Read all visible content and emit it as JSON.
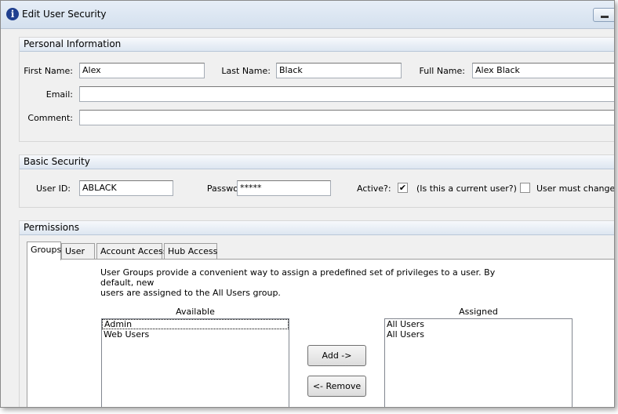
{
  "window": {
    "title": "Edit User Security"
  },
  "personal": {
    "header": "Personal Information",
    "first_name_label": "First Name:",
    "first_name": "Alex",
    "last_name_label": "Last Name:",
    "last_name": "Black",
    "full_name_label": "Full Name:",
    "full_name": "Alex Black",
    "email_label": "Email:",
    "email": "",
    "comment_label": "Comment:",
    "comment": ""
  },
  "security": {
    "header": "Basic Security",
    "user_id_label": "User ID:",
    "user_id": "ABLACK",
    "password_label": "Password:",
    "password": "*****",
    "active_label": "Active?:",
    "active_checked": true,
    "active_hint": "(Is this a current user?)",
    "must_change_checked": false,
    "must_change_label": "User must change pa"
  },
  "permissions": {
    "header": "Permissions",
    "tabs": [
      {
        "label": "Groups",
        "active": true
      },
      {
        "label": "User",
        "active": false
      },
      {
        "label": "Account Access",
        "active": false
      },
      {
        "label": "Hub Access",
        "active": false
      }
    ],
    "description_line1": "User Groups provide a convenient way to assign a predefined set of privileges to a user.  By default, new",
    "description_line2": "users are assigned to the All Users group.",
    "available_label": "Available",
    "available": [
      "Admin",
      "Web Users"
    ],
    "assigned_label": "Assigned",
    "assigned": [
      "All Users",
      "All Users"
    ],
    "add_button": "Add ->",
    "remove_button": "<- Remove"
  }
}
